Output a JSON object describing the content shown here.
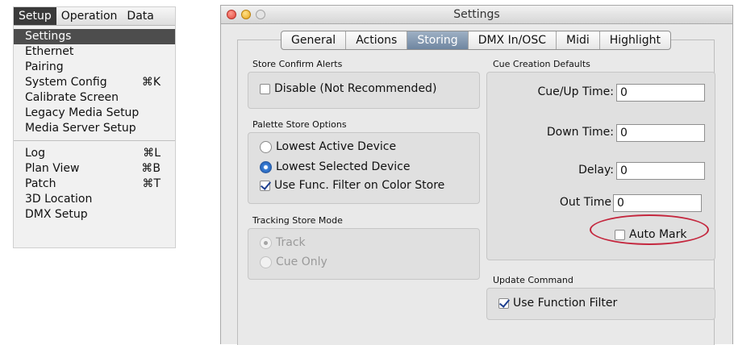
{
  "menu": {
    "bar": [
      "Setup",
      "Operation",
      "Data"
    ],
    "items": [
      {
        "label": "Settings",
        "shortcut": ""
      },
      {
        "label": "Ethernet",
        "shortcut": ""
      },
      {
        "label": "Pairing",
        "shortcut": ""
      },
      {
        "label": "System Config",
        "shortcut": "⌘K"
      },
      {
        "label": "Calibrate Screen",
        "shortcut": ""
      },
      {
        "label": "Legacy Media Setup",
        "shortcut": ""
      },
      {
        "label": "Media Server Setup",
        "shortcut": ""
      },
      {
        "label": "Log",
        "shortcut": "⌘L"
      },
      {
        "label": "Plan View",
        "shortcut": "⌘B"
      },
      {
        "label": "Patch",
        "shortcut": "⌘T"
      },
      {
        "label": "3D Location",
        "shortcut": ""
      },
      {
        "label": "DMX Setup",
        "shortcut": ""
      }
    ]
  },
  "window": {
    "title": "Settings",
    "tabs": [
      "General",
      "Actions",
      "Storing",
      "DMX In/OSC",
      "Midi",
      "Highlight"
    ],
    "active_tab": "Storing"
  },
  "store_confirm": {
    "title": "Store Confirm Alerts",
    "disable_label": "Disable (Not Recommended)",
    "disable_checked": false
  },
  "palette_store": {
    "title": "Palette Store Options",
    "opt_lowest_active": "Lowest Active Device",
    "opt_lowest_selected": "Lowest Selected Device",
    "selected": "Lowest Selected Device",
    "func_filter_label": "Use Func. Filter on Color Store",
    "func_filter_checked": true
  },
  "tracking": {
    "title": "Tracking Store Mode",
    "opt_track": "Track",
    "opt_cue_only": "Cue Only",
    "selected": "Track"
  },
  "cue_defaults": {
    "title": "Cue Creation Defaults",
    "cue_up_label": "Cue/Up Time:",
    "cue_up_value": "0",
    "down_label": "Down Time:",
    "down_value": "0",
    "delay_label": "Delay:",
    "delay_value": "0",
    "out_label": "Out Time",
    "out_value": "0",
    "auto_mark_label": "Auto Mark",
    "auto_mark_checked": false
  },
  "update_command": {
    "title": "Update Command",
    "use_function_filter_label": "Use Function Filter",
    "use_function_filter_checked": true
  },
  "colors": {
    "annotation": "#c4273e",
    "active_tab": "#7f94ad",
    "menu_highlight": "#4d4d4d"
  }
}
